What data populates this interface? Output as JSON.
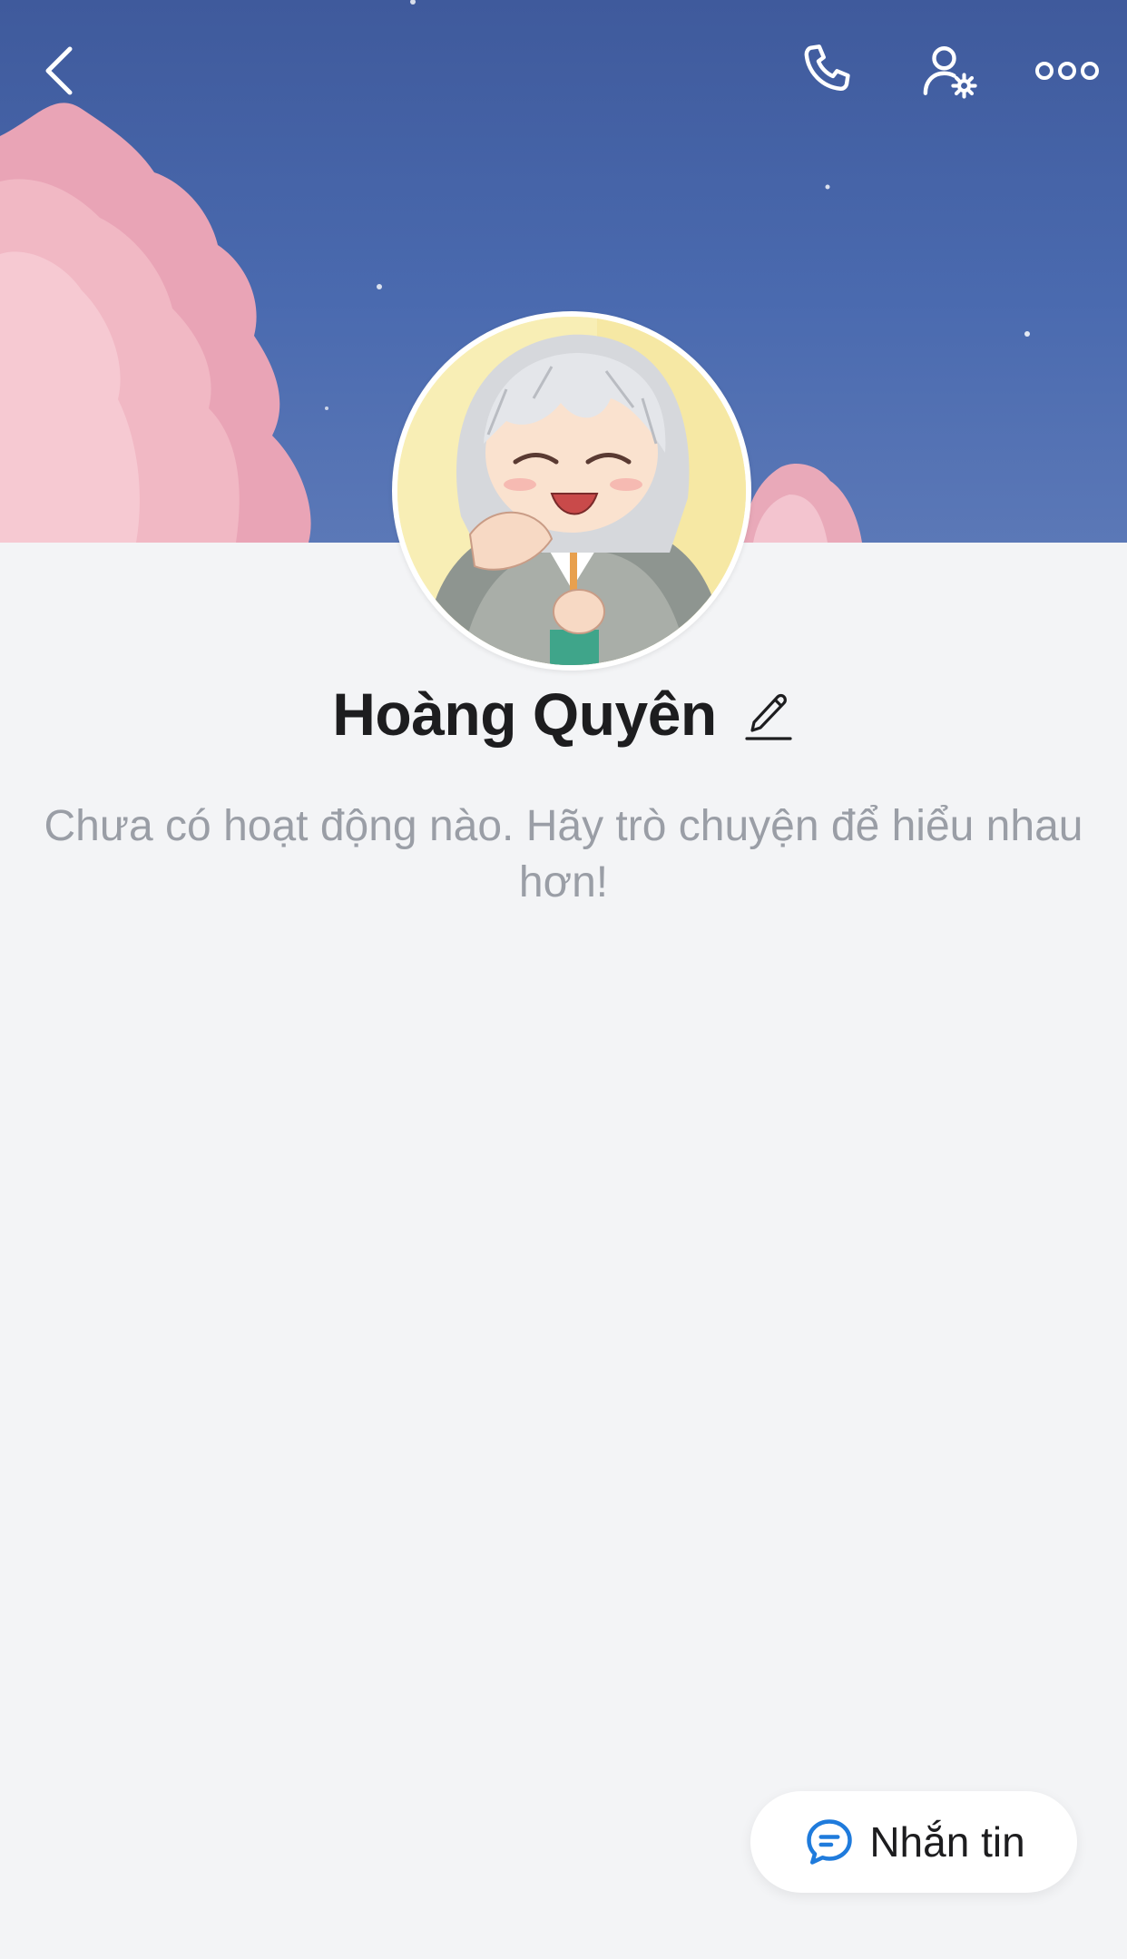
{
  "profile": {
    "name": "Hoàng Quyên",
    "empty_message": "Chưa có hoạt động nào. Hãy trò chuyện để hiểu nhau hơn!"
  },
  "actions": {
    "message_label": "Nhắn tin"
  },
  "icons": {
    "back": "chevron-left-icon",
    "call": "phone-icon",
    "user_settings": "user-settings-icon",
    "more": "more-dots-icon",
    "edit": "pencil-icon",
    "message": "chat-bubble-icon"
  },
  "colors": {
    "background": "#f3f4f6",
    "cover_sky": "#4a6aaf",
    "accent": "#1f7bdc",
    "text_primary": "#1d1d1f",
    "text_secondary": "#9a9ea6"
  }
}
